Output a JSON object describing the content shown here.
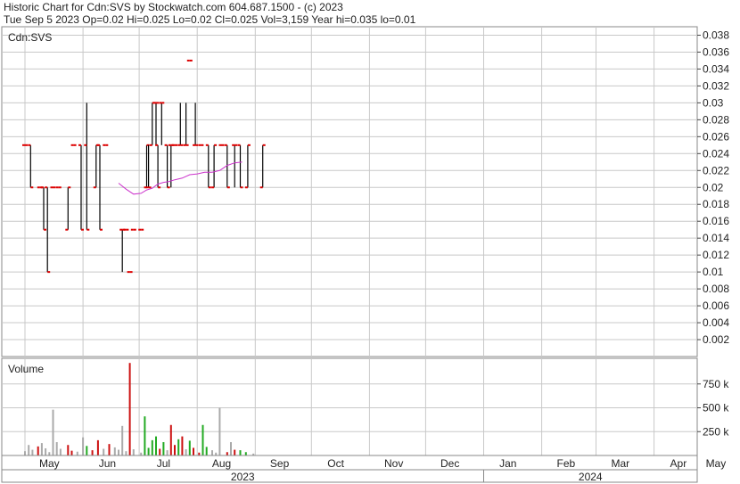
{
  "header": {
    "line1": "Historic Chart for Cdn:SVS by Stockwatch.com 604.687.1500 - (c) 2023",
    "line2": "Tue Sep  5 2023  Op=0.02  Hi=0.025  Lo=0.02  Cl=0.025  Vol=3,159  Year hi=0.035  lo=0.01"
  },
  "price_panel": {
    "label": "Cdn:SVS"
  },
  "volume_panel": {
    "label": "Volume"
  },
  "colors": {
    "bar": "#000000",
    "tick_up_down": "#dd0000",
    "moving_average": "#cc33cc",
    "grid": "#c8c8c8",
    "volume_up": "#22aa22",
    "volume_down": "#cc1111",
    "volume_flat": "#aaaaaa"
  },
  "chart_data": [
    {
      "type": "bar",
      "subtype": "ohlc",
      "ylim": [
        0,
        0.039
      ],
      "y_ticks": [
        "0.038",
        "0.036",
        "0.034",
        "0.032",
        "0.03",
        "0.028",
        "0.026",
        "0.024",
        "0.022",
        "0.02",
        "0.018",
        "0.016",
        "0.014",
        "0.012",
        "0.01",
        "0.008",
        "0.006",
        "0.004",
        "0.002"
      ],
      "x_month_labels": [
        "May",
        "Jun",
        "Jul",
        "Aug",
        "Sep",
        "Oct",
        "Nov",
        "Dec",
        "Jan",
        "Feb",
        "Mar",
        "Apr",
        "May"
      ],
      "year_labels": [
        "2023",
        "2024"
      ],
      "grid": true,
      "x_day_start": "2023-05-01",
      "ohlc": [
        {
          "d": "2023-05-01",
          "o": 0.025,
          "h": 0.025,
          "l": 0.025,
          "c": 0.025
        },
        {
          "d": "2023-05-04",
          "o": 0.025,
          "h": 0.025,
          "l": 0.02,
          "c": 0.02
        },
        {
          "d": "2023-05-09",
          "o": 0.02,
          "h": 0.02,
          "l": 0.02,
          "c": 0.02
        },
        {
          "d": "2023-05-11",
          "o": 0.02,
          "h": 0.02,
          "l": 0.015,
          "c": 0.015
        },
        {
          "d": "2023-05-13",
          "o": 0.02,
          "h": 0.02,
          "l": 0.01,
          "c": 0.01
        },
        {
          "d": "2023-05-16",
          "o": 0.02,
          "h": 0.02,
          "l": 0.02,
          "c": 0.02
        },
        {
          "d": "2023-05-19",
          "o": 0.02,
          "h": 0.02,
          "l": 0.02,
          "c": 0.02
        },
        {
          "d": "2023-05-24",
          "o": 0.015,
          "h": 0.02,
          "l": 0.015,
          "c": 0.02
        },
        {
          "d": "2023-05-27",
          "o": 0.025,
          "h": 0.025,
          "l": 0.025,
          "c": 0.025
        },
        {
          "d": "2023-05-31",
          "o": 0.025,
          "h": 0.025,
          "l": 0.015,
          "c": 0.015
        },
        {
          "d": "2023-06-03",
          "o": 0.025,
          "h": 0.03,
          "l": 0.015,
          "c": 0.015
        },
        {
          "d": "2023-06-08",
          "o": 0.02,
          "h": 0.025,
          "l": 0.02,
          "c": 0.025
        },
        {
          "d": "2023-06-10",
          "o": 0.025,
          "h": 0.025,
          "l": 0.015,
          "c": 0.015
        },
        {
          "d": "2023-06-13",
          "o": 0.025,
          "h": 0.025,
          "l": 0.025,
          "c": 0.025
        },
        {
          "d": "2023-06-22",
          "o": 0.015,
          "h": 0.015,
          "l": 0.01,
          "c": 0.015
        },
        {
          "d": "2023-06-24",
          "o": 0.015,
          "h": 0.015,
          "l": 0.015,
          "c": 0.015
        },
        {
          "d": "2023-06-26",
          "o": 0.01,
          "h": 0.01,
          "l": 0.01,
          "c": 0.01
        },
        {
          "d": "2023-06-28",
          "o": 0.015,
          "h": 0.015,
          "l": 0.015,
          "c": 0.015
        },
        {
          "d": "2023-07-02",
          "o": 0.015,
          "h": 0.015,
          "l": 0.015,
          "c": 0.015
        },
        {
          "d": "2023-07-05",
          "o": 0.02,
          "h": 0.025,
          "l": 0.02,
          "c": 0.025
        },
        {
          "d": "2023-07-06",
          "o": 0.02,
          "h": 0.025,
          "l": 0.02,
          "c": 0.02
        },
        {
          "d": "2023-07-08",
          "o": 0.025,
          "h": 0.03,
          "l": 0.025,
          "c": 0.03
        },
        {
          "d": "2023-07-10",
          "o": 0.03,
          "h": 0.03,
          "l": 0.025,
          "c": 0.03
        },
        {
          "d": "2023-07-11",
          "o": 0.025,
          "h": 0.025,
          "l": 0.02,
          "c": 0.02
        },
        {
          "d": "2023-07-13",
          "o": 0.03,
          "h": 0.03,
          "l": 0.025,
          "c": 0.03
        },
        {
          "d": "2023-07-16",
          "o": 0.025,
          "h": 0.025,
          "l": 0.02,
          "c": 0.02
        },
        {
          "d": "2023-07-18",
          "o": 0.025,
          "h": 0.025,
          "l": 0.02,
          "c": 0.025
        },
        {
          "d": "2023-07-20",
          "o": 0.025,
          "h": 0.025,
          "l": 0.025,
          "c": 0.025
        },
        {
          "d": "2023-07-23",
          "o": 0.025,
          "h": 0.03,
          "l": 0.025,
          "c": 0.025
        },
        {
          "d": "2023-07-26",
          "o": 0.025,
          "h": 0.03,
          "l": 0.025,
          "c": 0.025
        },
        {
          "d": "2023-07-28",
          "o": 0.035,
          "h": 0.035,
          "l": 0.035,
          "c": 0.035
        },
        {
          "d": "2023-07-31",
          "o": 0.025,
          "h": 0.03,
          "l": 0.025,
          "c": 0.025
        },
        {
          "d": "2023-08-03",
          "o": 0.025,
          "h": 0.025,
          "l": 0.025,
          "c": 0.025
        },
        {
          "d": "2023-08-07",
          "o": 0.025,
          "h": 0.025,
          "l": 0.02,
          "c": 0.02
        },
        {
          "d": "2023-08-10",
          "o": 0.02,
          "h": 0.025,
          "l": 0.02,
          "c": 0.025
        },
        {
          "d": "2023-08-14",
          "o": 0.025,
          "h": 0.025,
          "l": 0.025,
          "c": 0.025
        },
        {
          "d": "2023-08-17",
          "o": 0.025,
          "h": 0.025,
          "l": 0.02,
          "c": 0.02
        },
        {
          "d": "2023-08-21",
          "o": 0.025,
          "h": 0.025,
          "l": 0.02,
          "c": 0.025
        },
        {
          "d": "2023-08-24",
          "o": 0.025,
          "h": 0.025,
          "l": 0.02,
          "c": 0.02
        },
        {
          "d": "2023-08-28",
          "o": 0.02,
          "h": 0.025,
          "l": 0.02,
          "c": 0.025
        },
        {
          "d": "2023-09-05",
          "o": 0.02,
          "h": 0.025,
          "l": 0.02,
          "c": 0.025
        }
      ],
      "moving_average": [
        {
          "d": "2023-06-20",
          "v": 0.0205
        },
        {
          "d": "2023-06-24",
          "v": 0.0198
        },
        {
          "d": "2023-06-28",
          "v": 0.0192
        },
        {
          "d": "2023-07-02",
          "v": 0.0193
        },
        {
          "d": "2023-07-05",
          "v": 0.0197
        },
        {
          "d": "2023-07-08",
          "v": 0.0199
        },
        {
          "d": "2023-07-11",
          "v": 0.0204
        },
        {
          "d": "2023-07-14",
          "v": 0.0206
        },
        {
          "d": "2023-07-17",
          "v": 0.0207
        },
        {
          "d": "2023-07-20",
          "v": 0.0209
        },
        {
          "d": "2023-07-24",
          "v": 0.0211
        },
        {
          "d": "2023-07-28",
          "v": 0.0215
        },
        {
          "d": "2023-08-01",
          "v": 0.0216
        },
        {
          "d": "2023-08-05",
          "v": 0.0218
        },
        {
          "d": "2023-08-09",
          "v": 0.0218
        },
        {
          "d": "2023-08-13",
          "v": 0.022
        },
        {
          "d": "2023-08-17",
          "v": 0.0226
        },
        {
          "d": "2023-08-21",
          "v": 0.0229
        },
        {
          "d": "2023-08-25",
          "v": 0.023
        }
      ]
    },
    {
      "type": "bar",
      "subtype": "volume",
      "ylim": [
        0,
        1000000
      ],
      "y_ticks": [
        {
          "label": "750 k",
          "v": 750000
        },
        {
          "label": "500 k",
          "v": 500000
        },
        {
          "label": "250 k",
          "v": 250000
        }
      ],
      "volumes": [
        {
          "d": "2023-05-01",
          "v": 45000,
          "dir": "flat"
        },
        {
          "d": "2023-05-03",
          "v": 110000,
          "dir": "flat"
        },
        {
          "d": "2023-05-05",
          "v": 60000,
          "dir": "flat"
        },
        {
          "d": "2023-05-08",
          "v": 95000,
          "dir": "down"
        },
        {
          "d": "2023-05-10",
          "v": 130000,
          "dir": "flat"
        },
        {
          "d": "2023-05-12",
          "v": 75000,
          "dir": "flat"
        },
        {
          "d": "2023-05-14",
          "v": 35000,
          "dir": "flat"
        },
        {
          "d": "2023-05-16",
          "v": 480000,
          "dir": "flat"
        },
        {
          "d": "2023-05-18",
          "v": 140000,
          "dir": "flat"
        },
        {
          "d": "2023-05-20",
          "v": 70000,
          "dir": "flat"
        },
        {
          "d": "2023-05-24",
          "v": 110000,
          "dir": "down"
        },
        {
          "d": "2023-05-26",
          "v": 50000,
          "dir": "down"
        },
        {
          "d": "2023-05-29",
          "v": 40000,
          "dir": "flat"
        },
        {
          "d": "2023-06-01",
          "v": 190000,
          "dir": "flat"
        },
        {
          "d": "2023-06-03",
          "v": 100000,
          "dir": "up"
        },
        {
          "d": "2023-06-06",
          "v": 55000,
          "dir": "down"
        },
        {
          "d": "2023-06-09",
          "v": 160000,
          "dir": "down"
        },
        {
          "d": "2023-06-12",
          "v": 70000,
          "dir": "flat"
        },
        {
          "d": "2023-06-15",
          "v": 120000,
          "dir": "down"
        },
        {
          "d": "2023-06-18",
          "v": 85000,
          "dir": "flat"
        },
        {
          "d": "2023-06-20",
          "v": 60000,
          "dir": "flat"
        },
        {
          "d": "2023-06-22",
          "v": 310000,
          "dir": "flat"
        },
        {
          "d": "2023-06-24",
          "v": 45000,
          "dir": "flat"
        },
        {
          "d": "2023-06-26",
          "v": 970000,
          "dir": "down"
        },
        {
          "d": "2023-06-28",
          "v": 65000,
          "dir": "flat"
        },
        {
          "d": "2023-07-02",
          "v": 30000,
          "dir": "flat"
        },
        {
          "d": "2023-07-04",
          "v": 410000,
          "dir": "up"
        },
        {
          "d": "2023-07-06",
          "v": 80000,
          "dir": "up"
        },
        {
          "d": "2023-07-08",
          "v": 160000,
          "dir": "up"
        },
        {
          "d": "2023-07-10",
          "v": 200000,
          "dir": "up"
        },
        {
          "d": "2023-07-12",
          "v": 70000,
          "dir": "down"
        },
        {
          "d": "2023-07-14",
          "v": 140000,
          "dir": "up"
        },
        {
          "d": "2023-07-16",
          "v": 55000,
          "dir": "flat"
        },
        {
          "d": "2023-07-18",
          "v": 320000,
          "dir": "down"
        },
        {
          "d": "2023-07-20",
          "v": 110000,
          "dir": "down"
        },
        {
          "d": "2023-07-22",
          "v": 170000,
          "dir": "up"
        },
        {
          "d": "2023-07-24",
          "v": 200000,
          "dir": "down"
        },
        {
          "d": "2023-07-26",
          "v": 65000,
          "dir": "flat"
        },
        {
          "d": "2023-07-28",
          "v": 155000,
          "dir": "up"
        },
        {
          "d": "2023-07-30",
          "v": 80000,
          "dir": "down"
        },
        {
          "d": "2023-08-02",
          "v": 30000,
          "dir": "down"
        },
        {
          "d": "2023-08-04",
          "v": 320000,
          "dir": "up"
        },
        {
          "d": "2023-08-06",
          "v": 90000,
          "dir": "up"
        },
        {
          "d": "2023-08-09",
          "v": 55000,
          "dir": "flat"
        },
        {
          "d": "2023-08-11",
          "v": 30000,
          "dir": "flat"
        },
        {
          "d": "2023-08-13",
          "v": 500000,
          "dir": "flat"
        },
        {
          "d": "2023-08-17",
          "v": 35000,
          "dir": "down"
        },
        {
          "d": "2023-08-19",
          "v": 140000,
          "dir": "flat"
        },
        {
          "d": "2023-08-21",
          "v": 60000,
          "dir": "down"
        },
        {
          "d": "2023-08-24",
          "v": 55000,
          "dir": "up"
        },
        {
          "d": "2023-08-27",
          "v": 35000,
          "dir": "up"
        },
        {
          "d": "2023-08-31",
          "v": 20000,
          "dir": "flat"
        },
        {
          "d": "2023-09-05",
          "v": 3159,
          "dir": "up"
        }
      ]
    }
  ]
}
